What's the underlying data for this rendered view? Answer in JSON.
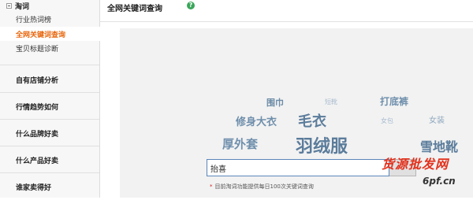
{
  "sidebar": {
    "group": {
      "label": "淘词"
    },
    "sub_items": [
      {
        "label": "行业热词榜",
        "active": false
      },
      {
        "label": "全网关键词查询",
        "active": true
      },
      {
        "label": "宝贝标题诊断",
        "active": false
      }
    ],
    "items": [
      {
        "label": "自有店铺分析"
      },
      {
        "label": "行情趋势如何"
      },
      {
        "label": "什么品牌好卖"
      },
      {
        "label": "什么产品好卖"
      },
      {
        "label": "谁家卖得好"
      }
    ]
  },
  "header": {
    "title": "全网关键词查询",
    "help_icon": "question-circle",
    "help_glyph": "?"
  },
  "keyword_cloud": [
    {
      "text": "围巾",
      "color": "#6b8ba6"
    },
    {
      "text": "短靴",
      "color": "#a9bcd0"
    },
    {
      "text": "打底裤",
      "color": "#6f8fac"
    },
    {
      "text": "修身大衣",
      "color": "#6f8fac"
    },
    {
      "text": "毛衣",
      "color": "#5b7c9b"
    },
    {
      "text": "女包",
      "color": "#a9bcd0"
    },
    {
      "text": "女装",
      "color": "#8ea7bf"
    },
    {
      "text": "厚外套",
      "color": "#6f8fac"
    },
    {
      "text": "羽绒服",
      "color": "#5b7c9b"
    },
    {
      "text": "雪地靴",
      "color": "#5b7c9b"
    }
  ],
  "search": {
    "value": "抬喜",
    "placeholder": ""
  },
  "note": {
    "star": "*",
    "text": "目前淘词功能提供每日100次关键词查询"
  },
  "watermark": {
    "line1": "货源批发网",
    "line2": "6pf.cn"
  }
}
